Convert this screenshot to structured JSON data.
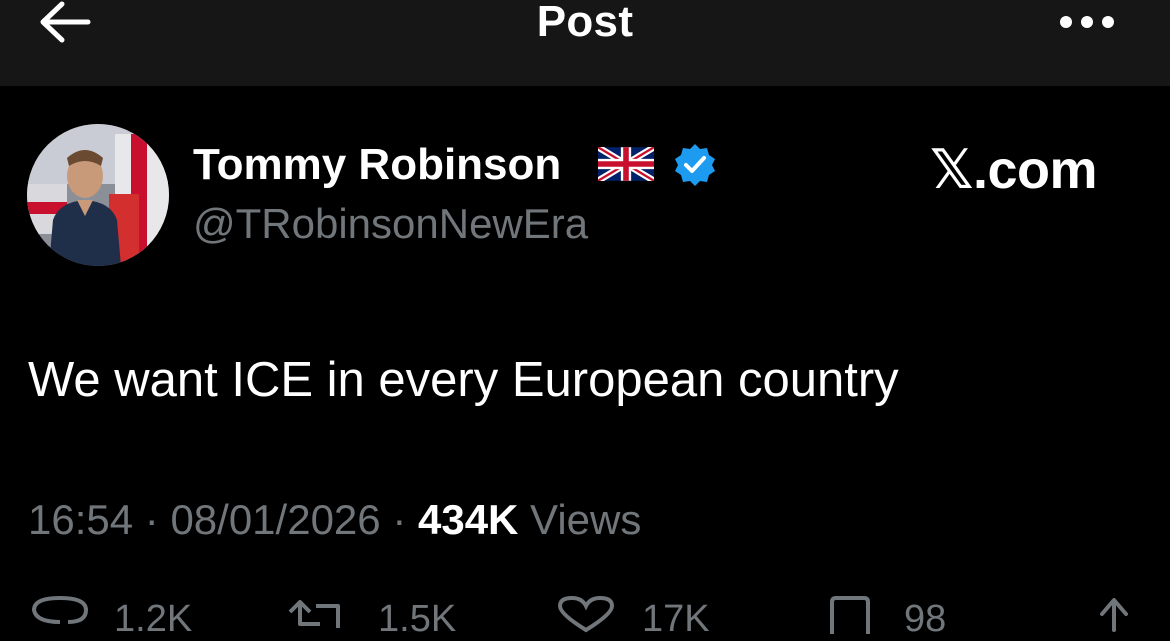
{
  "header": {
    "title": "Post",
    "back_icon": "arrow-left-icon",
    "more_icon": "more-horizontal-icon"
  },
  "author": {
    "display_name": "Tommy Robinson",
    "handle": "@TRobinsonNewEra",
    "flag_icon": "uk-flag-icon",
    "verified_icon": "verified-badge-icon",
    "verified_color": "#1d9bf0"
  },
  "watermark": "𝕏.com",
  "post": {
    "text": "We want ICE in every European country"
  },
  "meta": {
    "time": "16:54",
    "separator": " · ",
    "date": "08/01/2026",
    "views_count": "434K",
    "views_label": " Views"
  },
  "actions": {
    "replies": "1.2K",
    "reposts": "1.5K",
    "likes": "17K",
    "bookmarks": "98",
    "share_icon": "share-icon"
  },
  "colors": {
    "background": "#000000",
    "topbar": "#161616",
    "primary_text": "#ffffff",
    "secondary_text": "#71767b"
  }
}
